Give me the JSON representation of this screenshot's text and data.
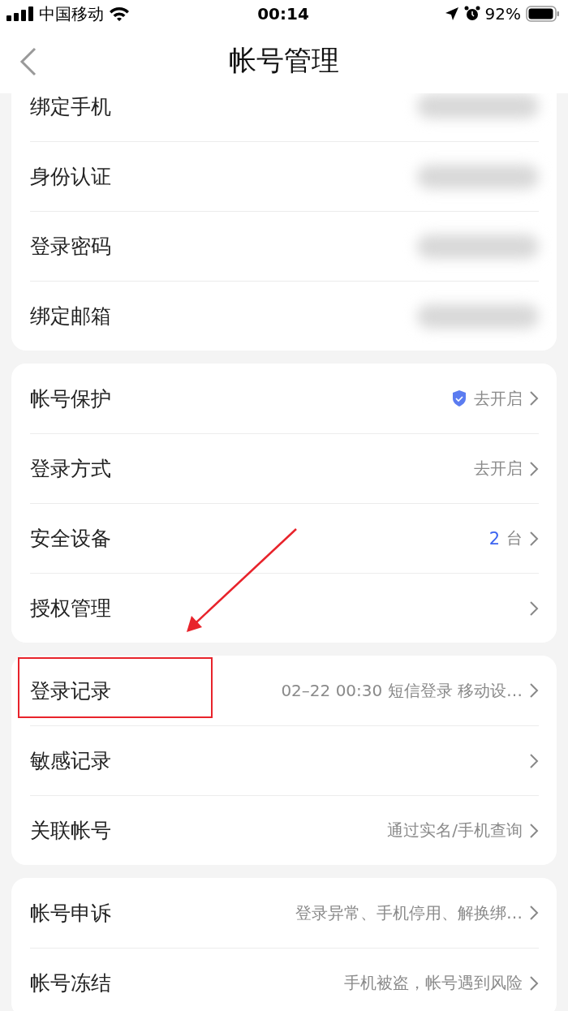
{
  "status_bar": {
    "carrier": "中国移动",
    "time": "00:14",
    "battery": "92%"
  },
  "nav": {
    "title": "帐号管理"
  },
  "groups": [
    {
      "rows": [
        {
          "label": "绑定手机",
          "kind": "blurred",
          "highlighted": false
        },
        {
          "label": "身份认证",
          "kind": "blurred",
          "highlighted": false
        },
        {
          "label": "登录密码",
          "kind": "blurred",
          "highlighted": false
        },
        {
          "label": "绑定邮箱",
          "kind": "blurred",
          "highlighted": false
        }
      ]
    },
    {
      "rows": [
        {
          "label": "帐号保护",
          "kind": "shield",
          "value": "去开启",
          "highlighted": false
        },
        {
          "label": "登录方式",
          "kind": "text",
          "value": "去开启",
          "highlighted": false
        },
        {
          "label": "安全设备",
          "kind": "count",
          "count": "2",
          "unit": "台",
          "highlighted": false
        },
        {
          "label": "授权管理",
          "kind": "plain",
          "highlighted": false
        }
      ]
    },
    {
      "rows": [
        {
          "label": "登录记录",
          "kind": "text",
          "value": "02–22 00:30 短信登录 移动设…",
          "highlighted": true
        },
        {
          "label": "敏感记录",
          "kind": "plain",
          "highlighted": false
        },
        {
          "label": "关联帐号",
          "kind": "text",
          "value": "通过实名/手机查询",
          "highlighted": false
        }
      ]
    },
    {
      "rows": [
        {
          "label": "帐号申诉",
          "kind": "text",
          "value": "登录异常、手机停用、解换绑…",
          "highlighted": false
        },
        {
          "label": "帐号冻结",
          "kind": "text",
          "value": "手机被盗，帐号遇到风险",
          "highlighted": false
        }
      ]
    }
  ]
}
